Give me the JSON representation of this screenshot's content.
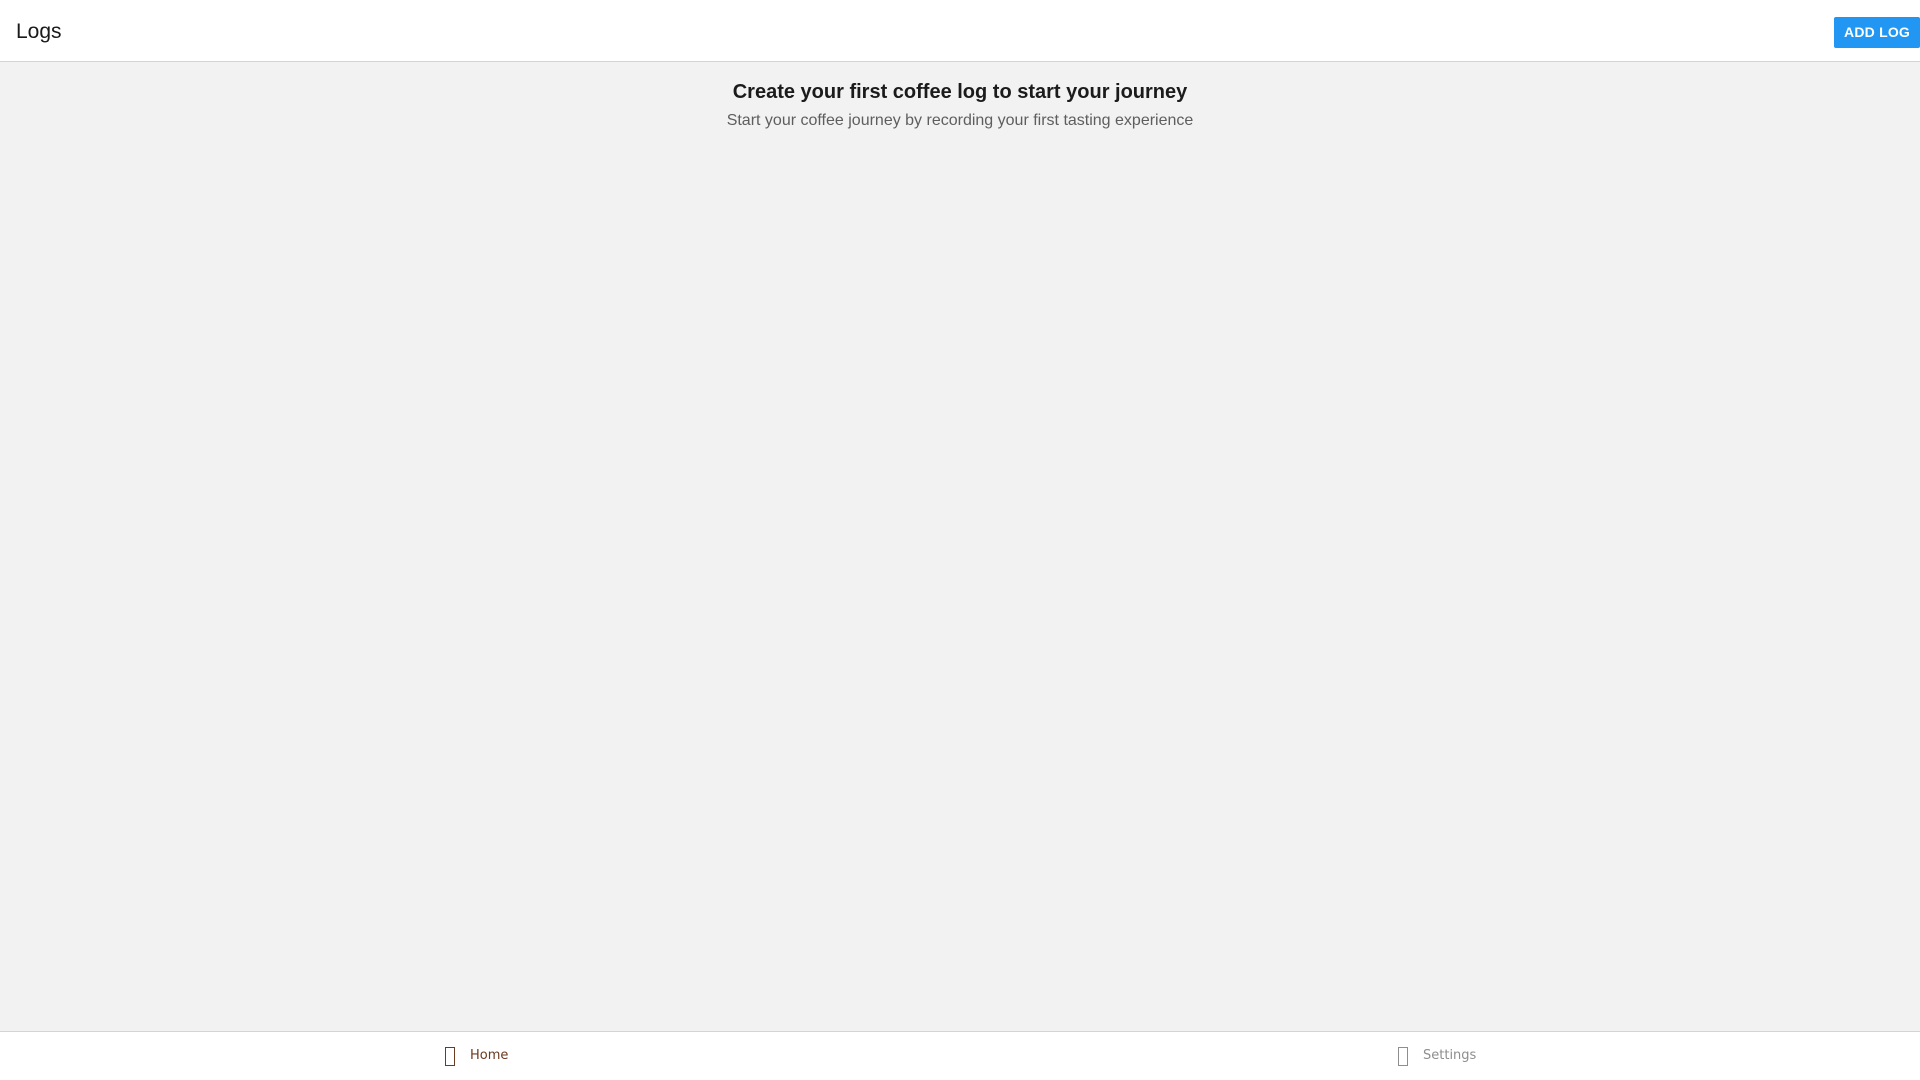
{
  "header": {
    "title": "Logs",
    "add_button_label": "ADD LOG"
  },
  "empty_state": {
    "title": "Create your first coffee log to start your journey",
    "subtitle": "Start your coffee journey by recording your first tasting experience"
  },
  "bottom_nav": {
    "items": [
      {
        "label": "Home",
        "icon": "home-icon",
        "active": true
      },
      {
        "label": "Settings",
        "icon": "settings-icon",
        "active": false
      }
    ]
  },
  "colors": {
    "accent": "#2196f3",
    "active_nav": "#6b3a1f",
    "inactive_nav": "#8e8e8e",
    "background": "#f2f2f2"
  }
}
